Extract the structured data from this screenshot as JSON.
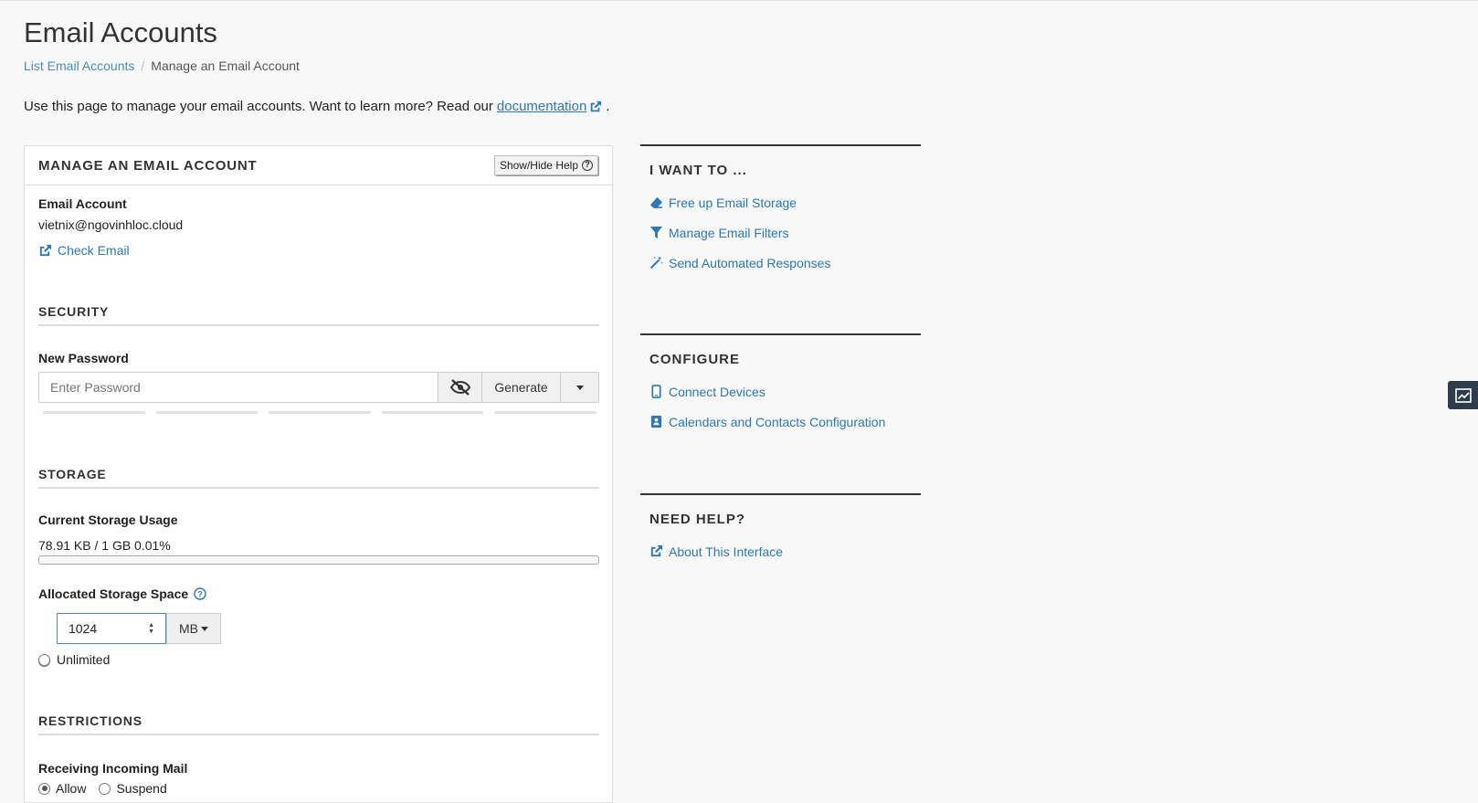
{
  "page": {
    "title": "Email Accounts",
    "breadcrumb": {
      "link": "List Email Accounts",
      "separator": "/",
      "current": "Manage an Email Account"
    },
    "intro_text": "Use this page to manage your email accounts. Want to learn more? Read our",
    "intro_link": "documentation",
    "intro_end": "."
  },
  "panel": {
    "title": "MANAGE AN EMAIL ACCOUNT",
    "help_toggle": "Show/Hide Help",
    "account_label": "Email Account",
    "account_value": "vietnix@ngovinhloc.cloud",
    "check_email": "Check Email",
    "security": {
      "title": "SECURITY",
      "new_password_label": "New Password",
      "password_placeholder": "Enter Password",
      "generate_label": "Generate"
    },
    "storage": {
      "title": "STORAGE",
      "current_label": "Current Storage Usage",
      "usage_text": "78.91 KB / 1 GB 0.01%",
      "usage_fraction": 0.0001,
      "allocated_label": "Allocated Storage Space",
      "allocated_value": "1024",
      "unit": "MB",
      "unlimited_label": "Unlimited",
      "selected_option": "custom"
    },
    "restrictions": {
      "title": "RESTRICTIONS",
      "incoming_label": "Receiving Incoming Mail",
      "allow_label": "Allow",
      "suspend_label": "Suspend",
      "selected_option": "allow"
    }
  },
  "sidebar": {
    "i_want_to": {
      "title": "I WANT TO ...",
      "items": [
        {
          "label": "Free up Email Storage",
          "icon": "eraser-icon"
        },
        {
          "label": "Manage Email Filters",
          "icon": "filter-icon"
        },
        {
          "label": "Send Automated Responses",
          "icon": "magic-wand-icon"
        }
      ]
    },
    "configure": {
      "title": "CONFIGURE",
      "items": [
        {
          "label": "Connect Devices",
          "icon": "mobile-icon"
        },
        {
          "label": "Calendars and Contacts Configuration",
          "icon": "address-book-icon"
        }
      ]
    },
    "help": {
      "title": "NEED HELP?",
      "items": [
        {
          "label": "About This Interface",
          "icon": "external-link-icon"
        }
      ]
    }
  },
  "colors": {
    "link": "#2a78b9",
    "background": "#f8f8f8",
    "side_tab": "#2d3b4a"
  }
}
